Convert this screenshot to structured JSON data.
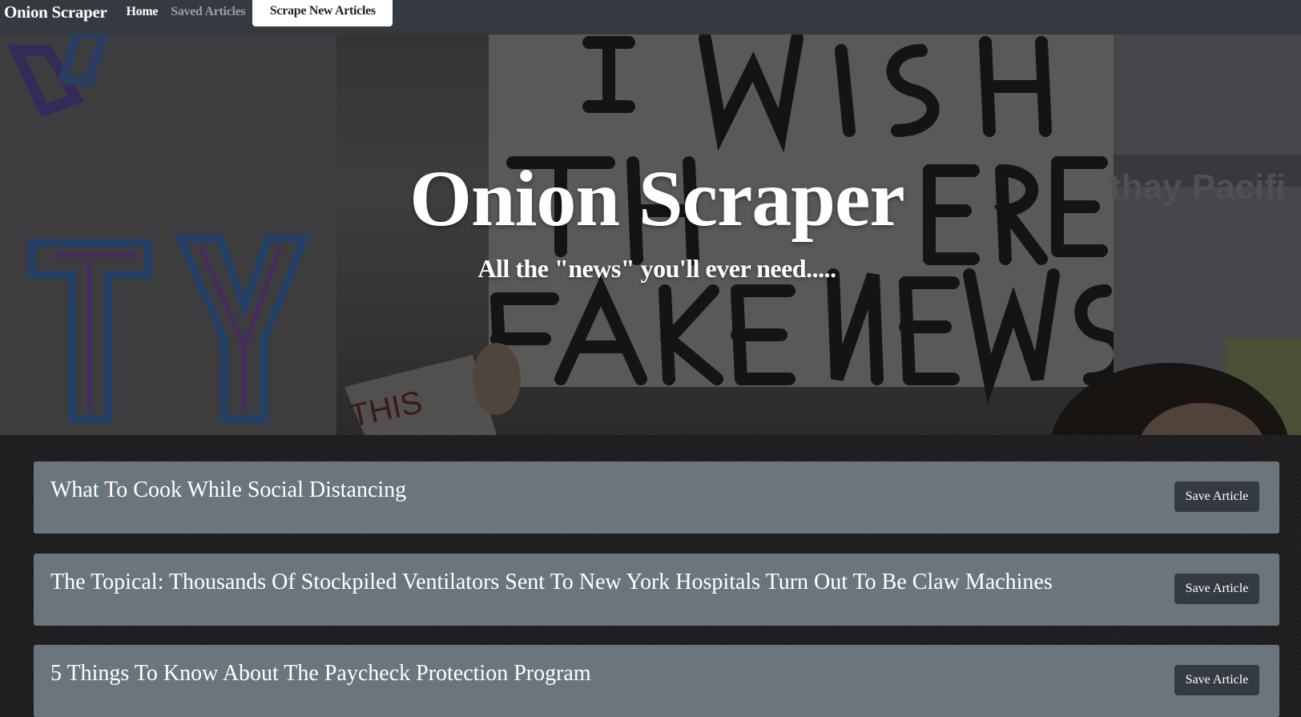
{
  "navbar": {
    "brand": "Onion Scraper",
    "home_label": "Home",
    "saved_label": "Saved Articles",
    "scrape_label": "Scrape New Articles"
  },
  "hero": {
    "title": "Onion Scraper",
    "subtitle": "All the \"news\" you'll ever need....."
  },
  "articles": [
    {
      "title": "What To Cook While Social Distancing",
      "button": "Save Article"
    },
    {
      "title": "The Topical: Thousands Of Stockpiled Ventilators Sent To New York Hospitals Turn Out To Be Claw Machines",
      "button": "Save Article"
    },
    {
      "title": "5 Things To Know About The Paycheck Protection Program",
      "button": "Save Article"
    }
  ],
  "colors": {
    "navbar": "#343a40",
    "card": "#6c757d",
    "button": "#343a40"
  }
}
